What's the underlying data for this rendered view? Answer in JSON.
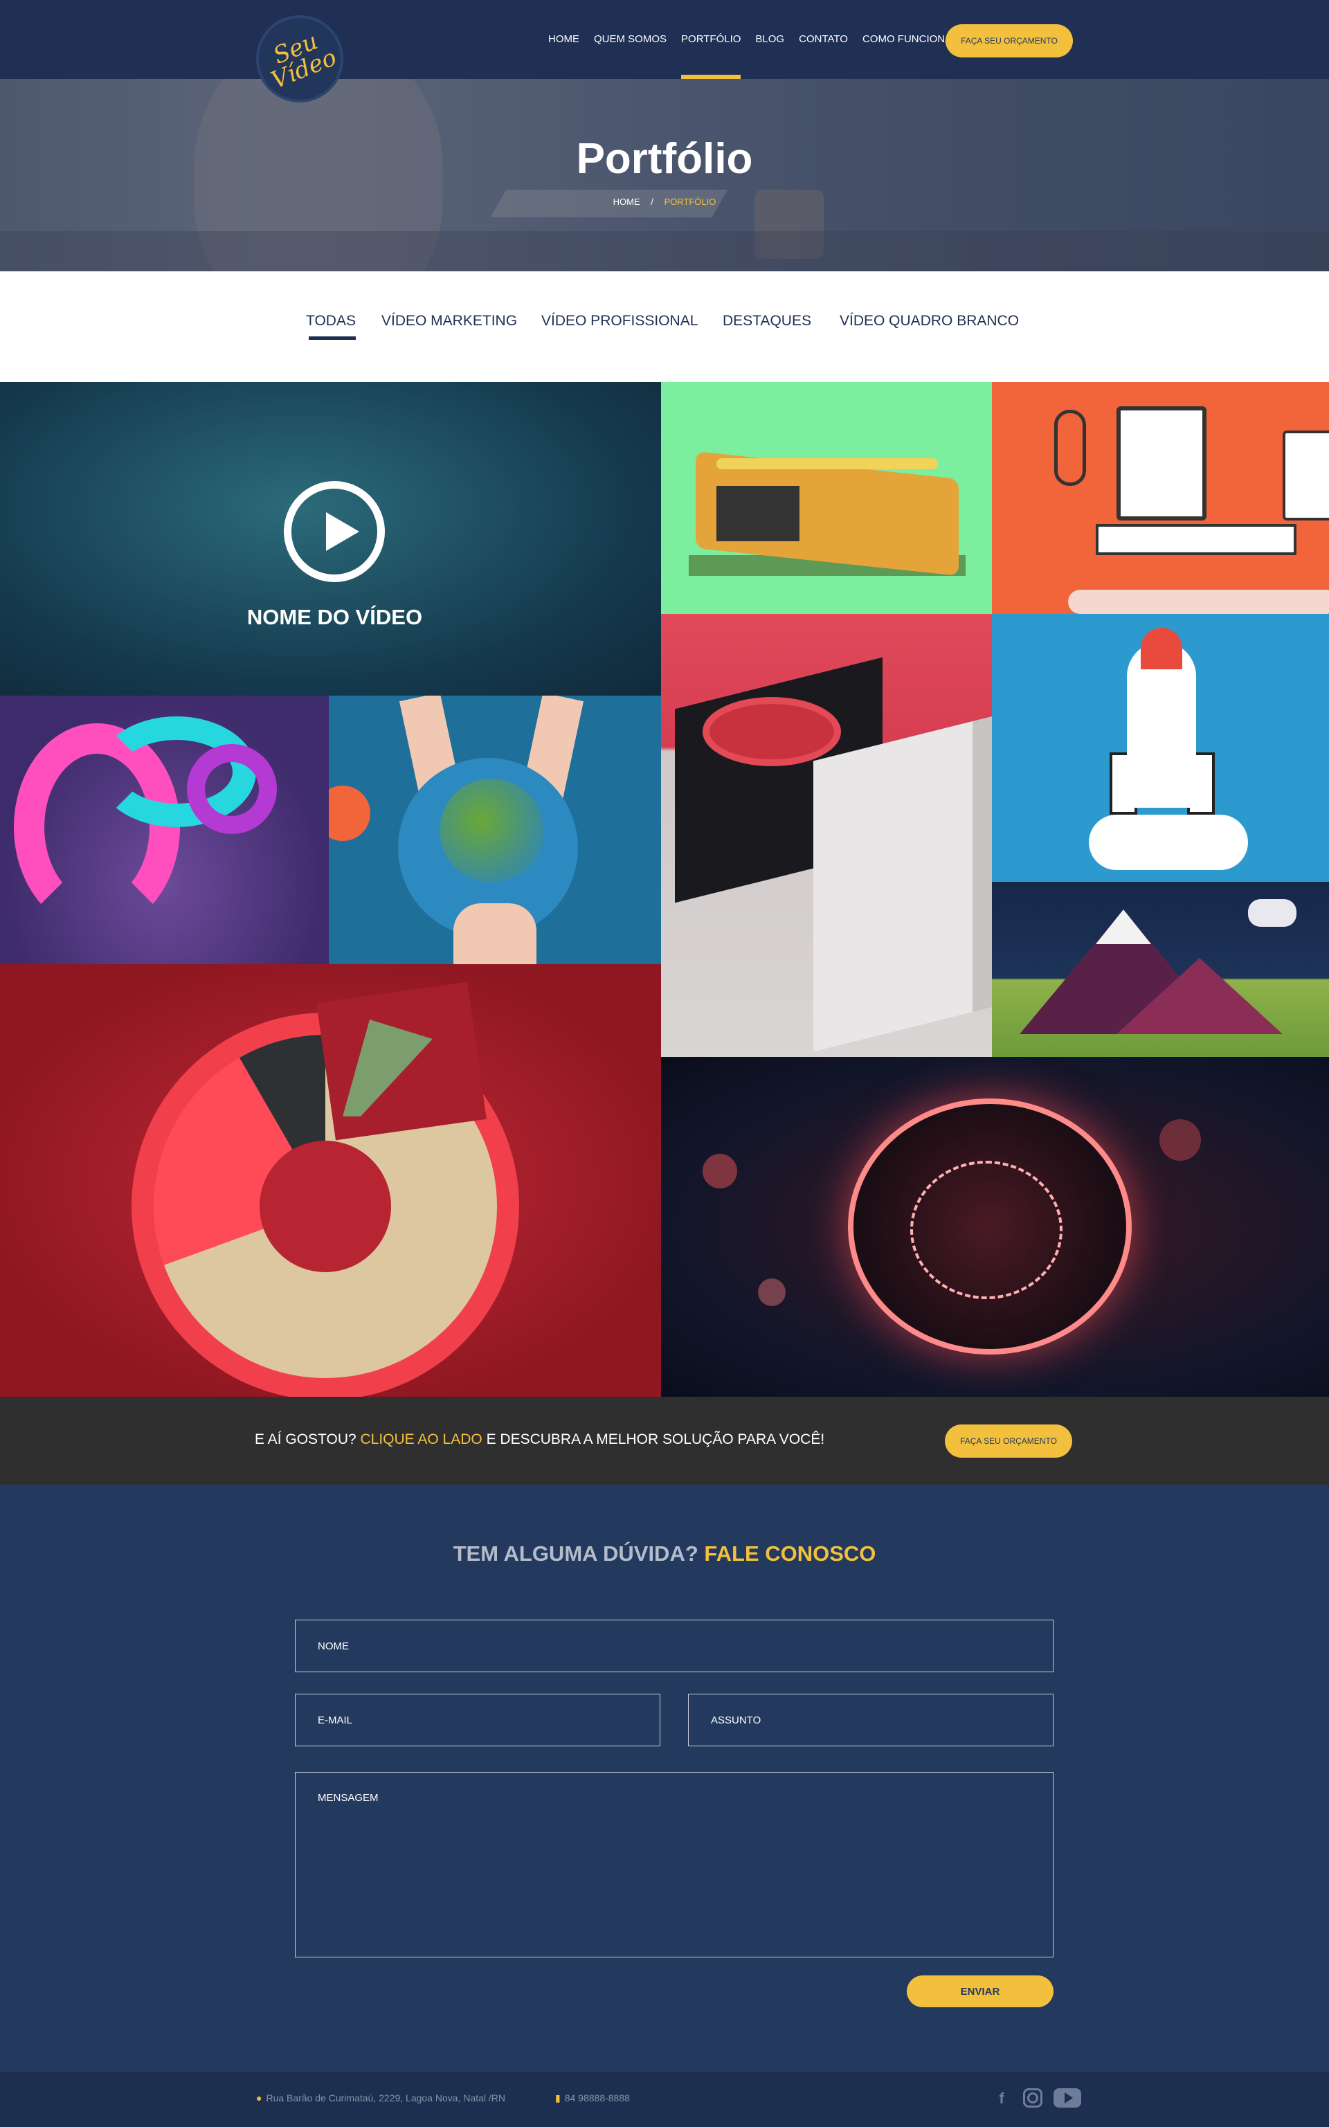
{
  "header": {
    "logo_text": "Seu Vídeo",
    "nav": [
      "HOME",
      "QUEM SOMOS",
      "PORTFÓLIO",
      "BLOG",
      "CONTATO",
      "COMO FUNCIONA"
    ],
    "active_nav": "PORTFÓLIO",
    "cta_label": "FAÇA SEU ORÇAMENTO"
  },
  "hero": {
    "title": "Portfólio",
    "breadcrumb": {
      "home": "HOME",
      "separator": "/",
      "current": "PORTFÓLIO"
    }
  },
  "filters": {
    "tabs": [
      "TODAS",
      "VÍDEO MARKETING",
      "VÍDEO PROFISSIONAL",
      "DESTAQUES",
      "VÍDEO QUADRO BRANCO"
    ],
    "active": "TODAS"
  },
  "portfolio": {
    "featured_video_name": "NOME DO VÍDEO",
    "play_icon": "play-circle-icon"
  },
  "cta_bar": {
    "text_before": "E AÍ GOSTOU? ",
    "highlight": "CLIQUE AO LADO",
    "text_after": " E DESCUBRA A MELHOR SOLUÇÃO PARA VOCÊ!",
    "button_label": "FAÇA SEU ORÇAMENTO"
  },
  "contact": {
    "title_before": "TEM ALGUMA DÚVIDA? ",
    "title_highlight": "FALE CONOSCO",
    "name_placeholder": "NOME",
    "email_placeholder": "E-MAIL",
    "subject_placeholder": "ASSUNTO",
    "message_placeholder": "MENSAGEM",
    "send_label": "ENVIAR"
  },
  "footer": {
    "address": "Rua Barão de Curimataú, 2229, Lagoa Nova, Natal /RN",
    "phone": "84 98888-8888",
    "socials": [
      "facebook-icon",
      "instagram-icon",
      "youtube-icon"
    ]
  },
  "colors": {
    "navy": "#1f3054",
    "accent": "#f3c03e",
    "contact_bg": "#233a5e",
    "cta_bar_bg": "#2f2f2f"
  }
}
